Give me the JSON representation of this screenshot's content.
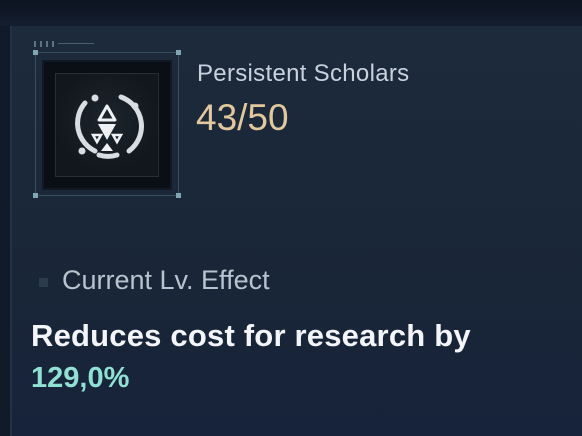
{
  "perk": {
    "name": "Persistent Scholars",
    "level": "43/50",
    "icon": "triangle-emblem-icon"
  },
  "effect": {
    "header": "Current Lv. Effect",
    "description": "Reduces cost for research by",
    "value": "129,0%"
  },
  "colors": {
    "background": "#1a2738",
    "title": "#c9d2dc",
    "level": "#e2c89b",
    "value": "#8fe1d4",
    "frame_corner": "#7ea6b4"
  }
}
